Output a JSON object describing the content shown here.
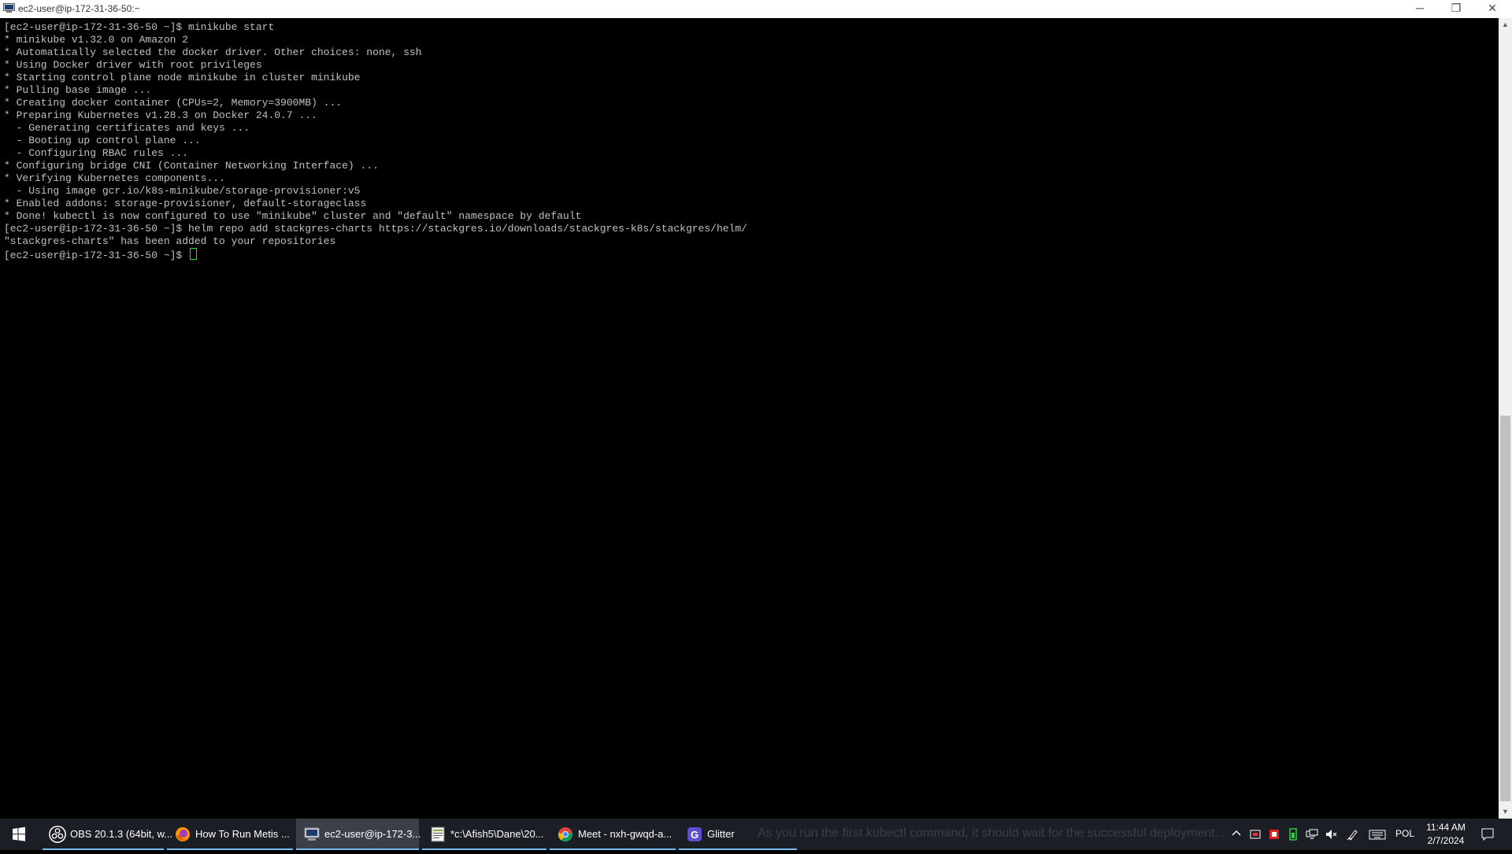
{
  "window": {
    "title": "ec2-user@ip-172-31-36-50:~",
    "minimize": "─",
    "maximize": "❐",
    "close": "✕"
  },
  "terminal": {
    "lines": [
      "[ec2-user@ip-172-31-36-50 ~]$ minikube start",
      "* minikube v1.32.0 on Amazon 2",
      "* Automatically selected the docker driver. Other choices: none, ssh",
      "* Using Docker driver with root privileges",
      "* Starting control plane node minikube in cluster minikube",
      "* Pulling base image ...",
      "* Creating docker container (CPUs=2, Memory=3900MB) ...",
      "* Preparing Kubernetes v1.28.3 on Docker 24.0.7 ...",
      "  - Generating certificates and keys ...",
      "  - Booting up control plane ...",
      "  - Configuring RBAC rules ...",
      "* Configuring bridge CNI (Container Networking Interface) ...",
      "* Verifying Kubernetes components...",
      "  - Using image gcr.io/k8s-minikube/storage-provisioner:v5",
      "* Enabled addons: storage-provisioner, default-storageclass",
      "* Done! kubectl is now configured to use \"minikube\" cluster and \"default\" namespace by default",
      "[ec2-user@ip-172-31-36-50 ~]$ helm repo add stackgres-charts https://stackgres.io/downloads/stackgres-k8s/stackgres/helm/",
      "\"stackgres-charts\" has been added to your repositories"
    ],
    "prompt": "[ec2-user@ip-172-31-36-50 ~]$ "
  },
  "scrollbar": {
    "up": "▲",
    "down": "▼"
  },
  "taskbar": {
    "tasks": [
      {
        "label": "OBS 20.1.3 (64bit, w...",
        "icon": "obs-icon",
        "color": "#2a2a2a"
      },
      {
        "label": "How To Run Metis ...",
        "icon": "firefox-icon",
        "color": "#e66000"
      },
      {
        "label": "ec2-user@ip-172-3...",
        "icon": "terminal-icon",
        "color": "#6a7a90"
      },
      {
        "label": "*c:\\Afish5\\Dane\\20...",
        "icon": "notepad-icon",
        "color": "#7fae3a"
      },
      {
        "label": "Meet - nxh-gwqd-a...",
        "icon": "chrome-icon",
        "color": "#4285f4"
      },
      {
        "label": "Glitter",
        "icon": "glitter-icon",
        "color": "#5b4fcf"
      }
    ],
    "caption": "As you run the first kubectl command, it should wait for the successful deployment...",
    "language": "POL",
    "time": "11:44 AM",
    "date": "2/7/2024",
    "accent": "#76b9ed"
  }
}
